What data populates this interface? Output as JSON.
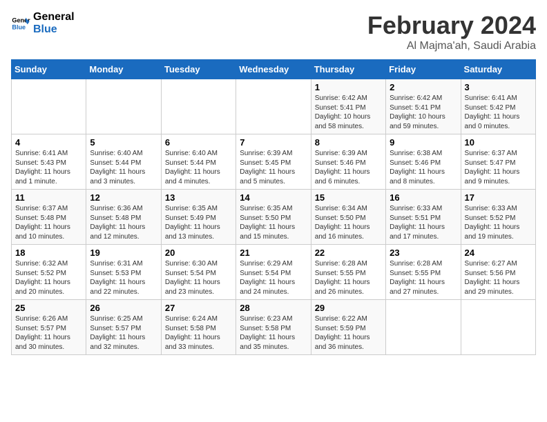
{
  "logo": {
    "line1": "General",
    "line2": "Blue"
  },
  "title": "February 2024",
  "subtitle": "Al Majma'ah, Saudi Arabia",
  "days_of_week": [
    "Sunday",
    "Monday",
    "Tuesday",
    "Wednesday",
    "Thursday",
    "Friday",
    "Saturday"
  ],
  "weeks": [
    [
      {
        "day": "",
        "info": ""
      },
      {
        "day": "",
        "info": ""
      },
      {
        "day": "",
        "info": ""
      },
      {
        "day": "",
        "info": ""
      },
      {
        "day": "1",
        "info": "Sunrise: 6:42 AM\nSunset: 5:41 PM\nDaylight: 10 hours and 58 minutes."
      },
      {
        "day": "2",
        "info": "Sunrise: 6:42 AM\nSunset: 5:41 PM\nDaylight: 10 hours and 59 minutes."
      },
      {
        "day": "3",
        "info": "Sunrise: 6:41 AM\nSunset: 5:42 PM\nDaylight: 11 hours and 0 minutes."
      }
    ],
    [
      {
        "day": "4",
        "info": "Sunrise: 6:41 AM\nSunset: 5:43 PM\nDaylight: 11 hours and 1 minute."
      },
      {
        "day": "5",
        "info": "Sunrise: 6:40 AM\nSunset: 5:44 PM\nDaylight: 11 hours and 3 minutes."
      },
      {
        "day": "6",
        "info": "Sunrise: 6:40 AM\nSunset: 5:44 PM\nDaylight: 11 hours and 4 minutes."
      },
      {
        "day": "7",
        "info": "Sunrise: 6:39 AM\nSunset: 5:45 PM\nDaylight: 11 hours and 5 minutes."
      },
      {
        "day": "8",
        "info": "Sunrise: 6:39 AM\nSunset: 5:46 PM\nDaylight: 11 hours and 6 minutes."
      },
      {
        "day": "9",
        "info": "Sunrise: 6:38 AM\nSunset: 5:46 PM\nDaylight: 11 hours and 8 minutes."
      },
      {
        "day": "10",
        "info": "Sunrise: 6:37 AM\nSunset: 5:47 PM\nDaylight: 11 hours and 9 minutes."
      }
    ],
    [
      {
        "day": "11",
        "info": "Sunrise: 6:37 AM\nSunset: 5:48 PM\nDaylight: 11 hours and 10 minutes."
      },
      {
        "day": "12",
        "info": "Sunrise: 6:36 AM\nSunset: 5:48 PM\nDaylight: 11 hours and 12 minutes."
      },
      {
        "day": "13",
        "info": "Sunrise: 6:35 AM\nSunset: 5:49 PM\nDaylight: 11 hours and 13 minutes."
      },
      {
        "day": "14",
        "info": "Sunrise: 6:35 AM\nSunset: 5:50 PM\nDaylight: 11 hours and 15 minutes."
      },
      {
        "day": "15",
        "info": "Sunrise: 6:34 AM\nSunset: 5:50 PM\nDaylight: 11 hours and 16 minutes."
      },
      {
        "day": "16",
        "info": "Sunrise: 6:33 AM\nSunset: 5:51 PM\nDaylight: 11 hours and 17 minutes."
      },
      {
        "day": "17",
        "info": "Sunrise: 6:33 AM\nSunset: 5:52 PM\nDaylight: 11 hours and 19 minutes."
      }
    ],
    [
      {
        "day": "18",
        "info": "Sunrise: 6:32 AM\nSunset: 5:52 PM\nDaylight: 11 hours and 20 minutes."
      },
      {
        "day": "19",
        "info": "Sunrise: 6:31 AM\nSunset: 5:53 PM\nDaylight: 11 hours and 22 minutes."
      },
      {
        "day": "20",
        "info": "Sunrise: 6:30 AM\nSunset: 5:54 PM\nDaylight: 11 hours and 23 minutes."
      },
      {
        "day": "21",
        "info": "Sunrise: 6:29 AM\nSunset: 5:54 PM\nDaylight: 11 hours and 24 minutes."
      },
      {
        "day": "22",
        "info": "Sunrise: 6:28 AM\nSunset: 5:55 PM\nDaylight: 11 hours and 26 minutes."
      },
      {
        "day": "23",
        "info": "Sunrise: 6:28 AM\nSunset: 5:55 PM\nDaylight: 11 hours and 27 minutes."
      },
      {
        "day": "24",
        "info": "Sunrise: 6:27 AM\nSunset: 5:56 PM\nDaylight: 11 hours and 29 minutes."
      }
    ],
    [
      {
        "day": "25",
        "info": "Sunrise: 6:26 AM\nSunset: 5:57 PM\nDaylight: 11 hours and 30 minutes."
      },
      {
        "day": "26",
        "info": "Sunrise: 6:25 AM\nSunset: 5:57 PM\nDaylight: 11 hours and 32 minutes."
      },
      {
        "day": "27",
        "info": "Sunrise: 6:24 AM\nSunset: 5:58 PM\nDaylight: 11 hours and 33 minutes."
      },
      {
        "day": "28",
        "info": "Sunrise: 6:23 AM\nSunset: 5:58 PM\nDaylight: 11 hours and 35 minutes."
      },
      {
        "day": "29",
        "info": "Sunrise: 6:22 AM\nSunset: 5:59 PM\nDaylight: 11 hours and 36 minutes."
      },
      {
        "day": "",
        "info": ""
      },
      {
        "day": "",
        "info": ""
      }
    ]
  ]
}
